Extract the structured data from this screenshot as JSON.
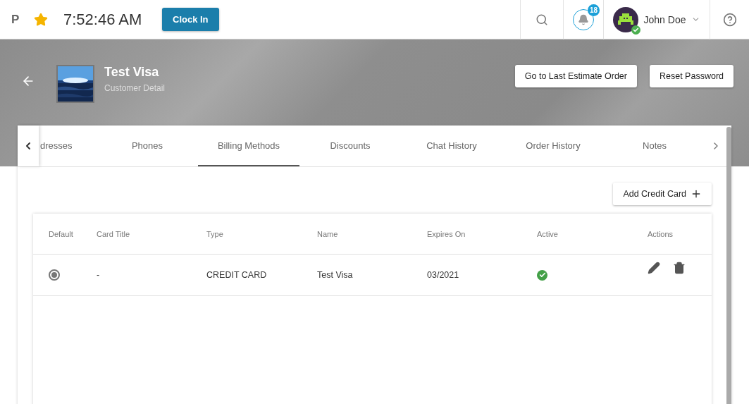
{
  "top_bar": {
    "brand": "P",
    "time": "7:52:46 AM",
    "clock_in": "Clock In",
    "notifications": "18",
    "user": "John Doe"
  },
  "customer": {
    "name": "Test Visa",
    "subtitle": "Customer Detail",
    "buttons": [
      "Go to Last Estimate Order",
      "Reset Password"
    ]
  },
  "tabs": [
    {
      "label": "dresses",
      "selected": false
    },
    {
      "label": "Phones",
      "selected": false
    },
    {
      "label": "Billing Methods",
      "selected": true
    },
    {
      "label": "Discounts",
      "selected": false
    },
    {
      "label": "Chat History",
      "selected": false
    },
    {
      "label": "Order History",
      "selected": false
    },
    {
      "label": "Notes",
      "selected": false
    }
  ],
  "add_button": "Add Credit Card",
  "table": {
    "columns": [
      "Default",
      "Card Title",
      "Type",
      "Name",
      "Expires On",
      "Active",
      "Actions"
    ],
    "rows": [
      {
        "default": true,
        "card_title": "-",
        "type": "CREDIT CARD",
        "name": "Test Visa",
        "expires": "03/2021",
        "active": true
      }
    ]
  }
}
